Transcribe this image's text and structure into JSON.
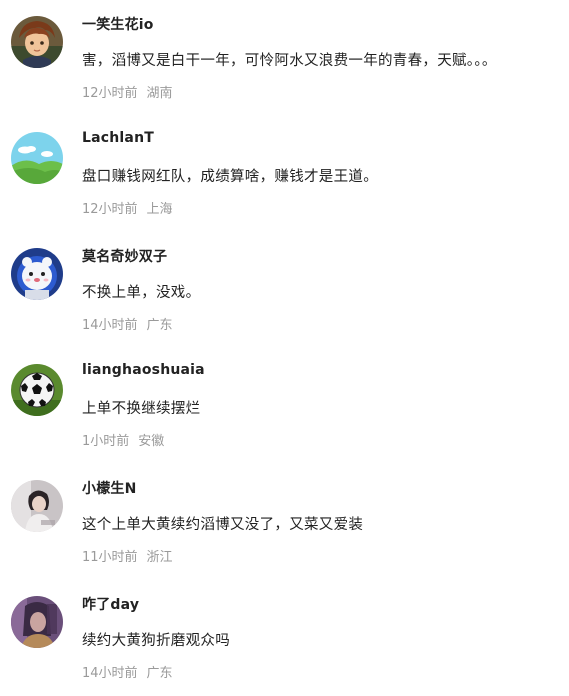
{
  "comments": [
    {
      "username": "一笑生花io",
      "text": "害，滔博又是白干一年，可怜阿水又浪费一年的青春，天赋。。。",
      "time": "12小时前",
      "location": "湖南",
      "avatar_icon": "anime-boy-avatar"
    },
    {
      "username": "LachlanT",
      "text": "盘口赚钱网红队，成绩算啥，赚钱才是王道。",
      "time": "12小时前",
      "location": "上海",
      "avatar_icon": "landscape-sky-hill-avatar"
    },
    {
      "username": "莫名奇妙双子",
      "text": "不换上单，没戏。",
      "time": "14小时前",
      "location": "广东",
      "avatar_icon": "white-bear-astronaut-avatar"
    },
    {
      "username": "lianghaoshuaia",
      "text": "上单不换继续摆烂",
      "time": "1小时前",
      "location": "安徽",
      "avatar_icon": "soccer-ball-avatar"
    },
    {
      "username": "小檬生N",
      "text": "这个上单大黄续约滔博又没了，又菜又爱装",
      "time": "11小时前",
      "location": "浙江",
      "avatar_icon": "photo-person-avatar"
    },
    {
      "username": "咋了day",
      "text": "续约大黄狗折磨观众吗",
      "time": "14小时前",
      "location": "广东",
      "avatar_icon": "purple-portrait-avatar"
    }
  ],
  "colors": {
    "username": "#222222",
    "text": "#222222",
    "meta": "#9a9a9a",
    "background": "#ffffff"
  }
}
